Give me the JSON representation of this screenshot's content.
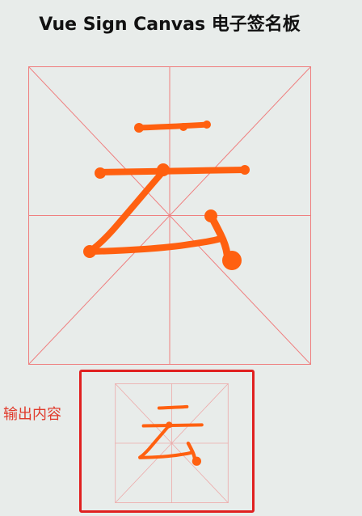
{
  "app": {
    "title": "Vue Sign Canvas 电子签名板"
  },
  "output": {
    "label": "输出内容"
  },
  "grid": {
    "guide_color": "#ef7f7f"
  },
  "stroke": {
    "color": "#ff6010"
  }
}
